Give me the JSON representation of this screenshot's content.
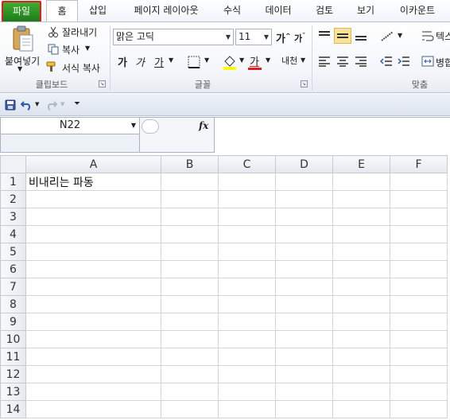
{
  "tabs": {
    "file": "파일",
    "home": "홈",
    "insert": "삽입",
    "page_layout": "페이지 레이아웃",
    "formulas": "수식",
    "data": "데이터",
    "review": "검토",
    "view": "보기",
    "acrobat": "이카운트"
  },
  "clipboard": {
    "paste": "붙여넣기",
    "cut": "잘라내기",
    "copy": "복사",
    "format_painter": "서식 복사",
    "group_label": "클립보드"
  },
  "font": {
    "name": "맑은 고딕",
    "size": "11",
    "bold": "가",
    "italic": "가",
    "underline": "가",
    "font_color": "가",
    "phonetic": "내천",
    "group_label": "글꼴"
  },
  "alignment": {
    "wrap_label": "텍스",
    "merge_label": "병합",
    "group_label": "맞춤"
  },
  "formula_bar": {
    "name_box": "N22",
    "fx": "fx",
    "value": ""
  },
  "sheet": {
    "columns": [
      "A",
      "B",
      "C",
      "D",
      "E",
      "F"
    ],
    "rows": [
      "1",
      "2",
      "3",
      "4",
      "5",
      "6",
      "7",
      "8",
      "9",
      "10",
      "11",
      "12",
      "13",
      "14"
    ],
    "cells": {
      "A1": "비내리는 파동"
    }
  },
  "colors": {
    "file_tab": "#2e9a28",
    "highlight_outline": "#e02020",
    "ribbon_bg": "#f4f6fa",
    "header_bg": "#e4e8ee"
  }
}
